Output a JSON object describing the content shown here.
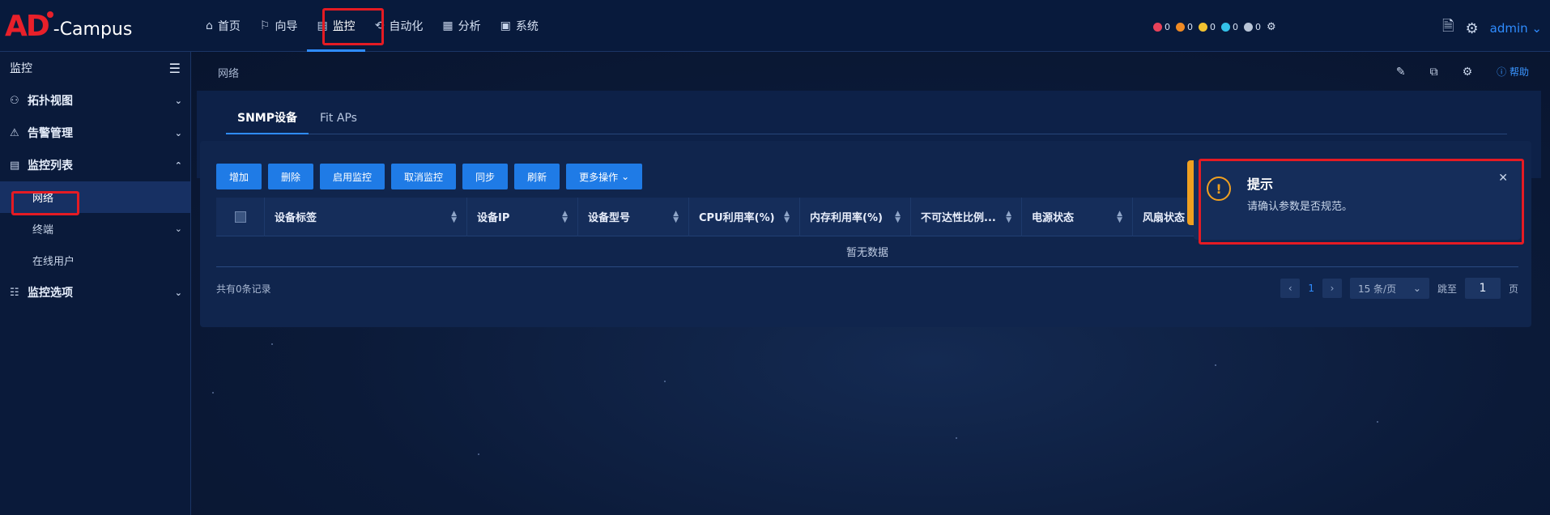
{
  "brand": {
    "logo_text": "AD",
    "product": "-Campus"
  },
  "nav": [
    {
      "icon": "home-icon",
      "glyph": "⌂",
      "label": "首页"
    },
    {
      "icon": "guide-icon",
      "glyph": "⚐",
      "label": "向导"
    },
    {
      "icon": "monitor-icon",
      "glyph": "▤",
      "label": "监控",
      "active": true
    },
    {
      "icon": "automation-icon",
      "glyph": "⟲",
      "label": "自动化"
    },
    {
      "icon": "analysis-icon",
      "glyph": "▦",
      "label": "分析"
    },
    {
      "icon": "system-icon",
      "glyph": "▣",
      "label": "系统"
    }
  ],
  "alarm_counts": [
    {
      "color": "#e8425a",
      "count": "0"
    },
    {
      "color": "#f08a24",
      "count": "0"
    },
    {
      "color": "#f2c230",
      "count": "0"
    },
    {
      "color": "#33c1e8",
      "count": "0"
    },
    {
      "color": "#b8c4d6",
      "count": "0"
    }
  ],
  "user": {
    "name": "admin"
  },
  "sidebar": {
    "title": "监控",
    "items": [
      {
        "label": "拓扑视图",
        "icon": "topology-icon",
        "expanded": false
      },
      {
        "label": "告警管理",
        "icon": "warning-icon",
        "expanded": false
      },
      {
        "label": "监控列表",
        "icon": "list-icon",
        "expanded": true,
        "children": [
          {
            "label": "网络",
            "active": true
          },
          {
            "label": "终端",
            "has_children": true
          },
          {
            "label": "在线用户"
          }
        ]
      },
      {
        "label": "监控选项",
        "icon": "options-icon",
        "expanded": false
      }
    ]
  },
  "breadcrumb": "网络",
  "help_label": "帮助",
  "tabs": [
    {
      "label": "SNMP设备",
      "active": true
    },
    {
      "label": "Fit APs",
      "active": false
    }
  ],
  "buttons": [
    "增加",
    "删除",
    "启用监控",
    "取消监控",
    "同步",
    "刷新",
    "更多操作"
  ],
  "table": {
    "columns": [
      "设备标签",
      "设备IP",
      "设备型号",
      "CPU利用率(%)",
      "内存利用率(%)",
      "不可达性比例...",
      "电源状态",
      "风扇状态"
    ],
    "empty_text": "暂无数据"
  },
  "pagination": {
    "total_text": "共有0条记录",
    "current_page": "1",
    "page_size": "15 条/页",
    "goto_label": "跳至",
    "goto_value": "1",
    "page_suffix": "页"
  },
  "toast": {
    "title": "提示",
    "message": "请确认参数是否规范。"
  }
}
